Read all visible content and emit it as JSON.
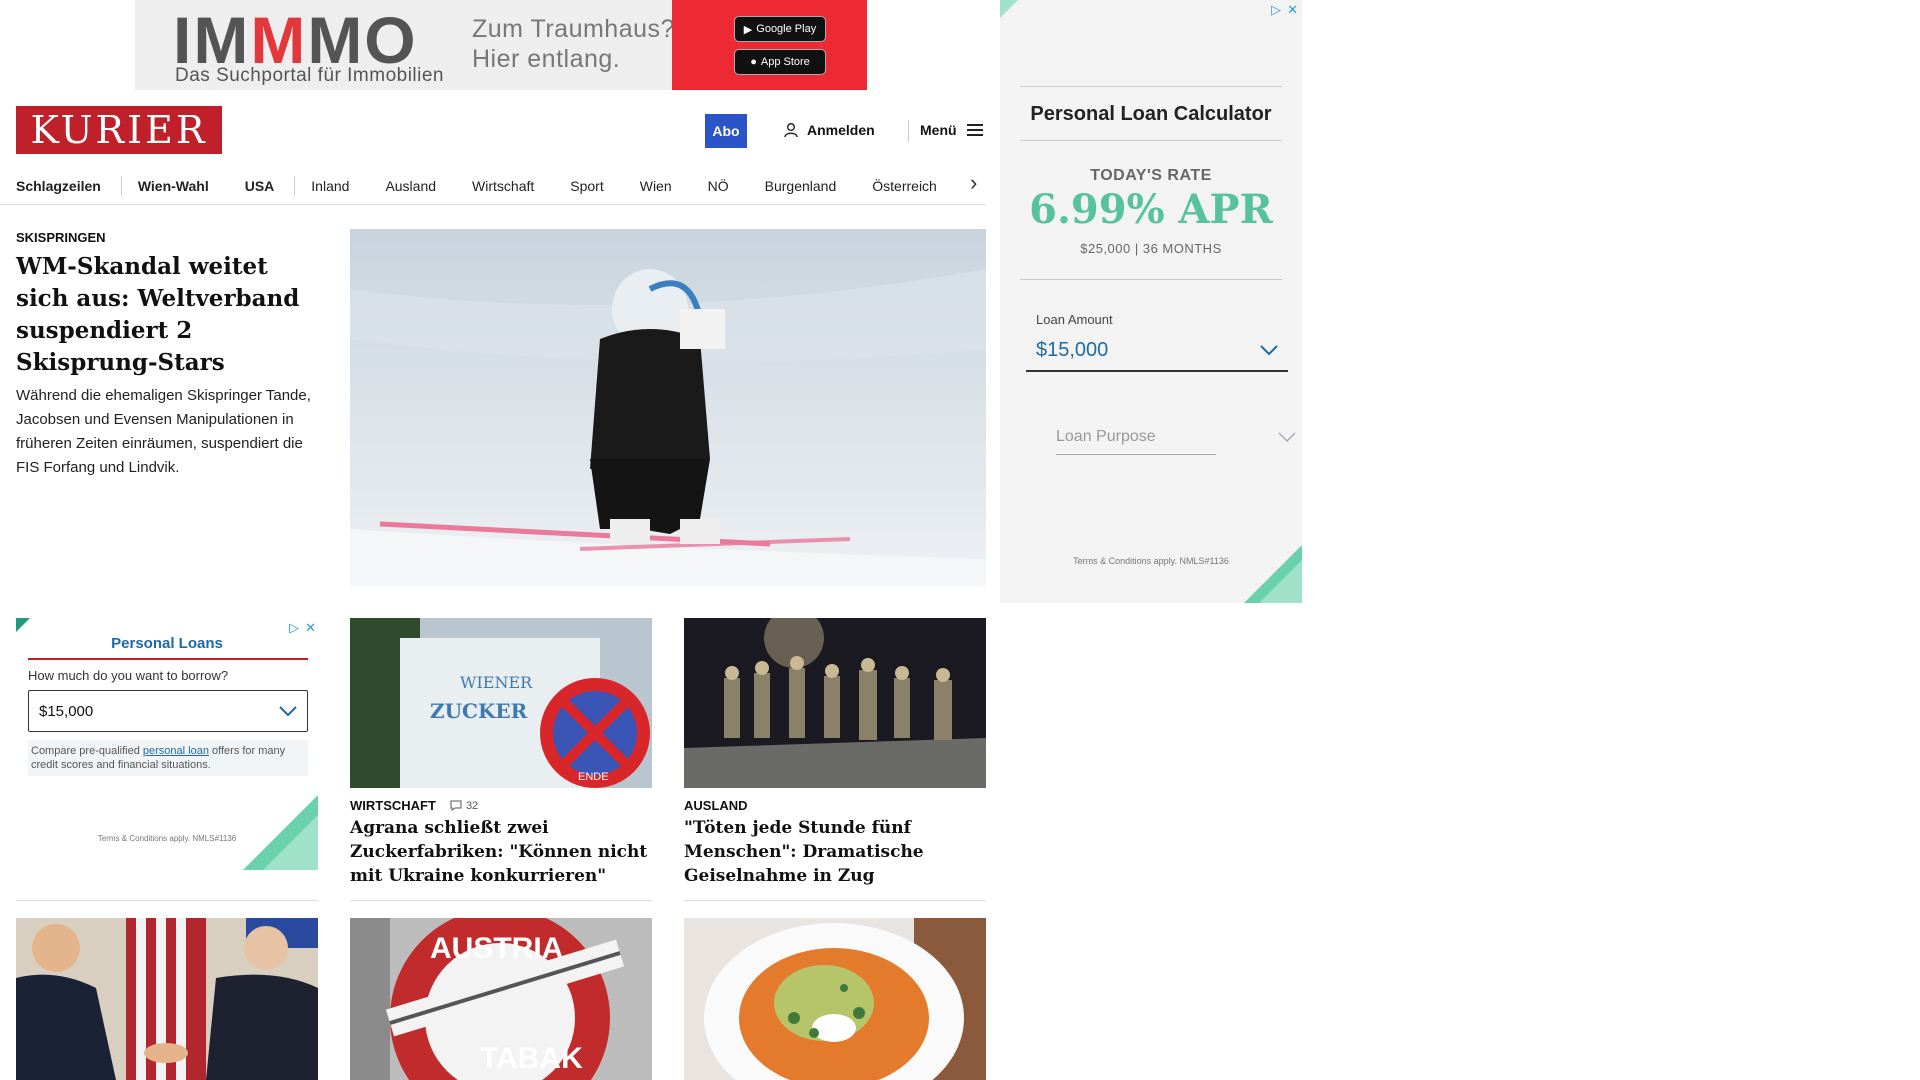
{
  "top_ad": {
    "logo_prefix": "IM",
    "logo_highlight": "M",
    "logo_suffix": "MO",
    "subtitle": "Das Suchportal für Immobilien",
    "slogan_line1": "Zum Traumhaus?",
    "slogan_line2": "Hier entlang.",
    "google_play_label": "Google Play",
    "app_store_label": "App Store"
  },
  "header": {
    "logo": "KURIER",
    "abo": "Abo",
    "login": "Anmelden",
    "menu": "Menü"
  },
  "nav": {
    "items": [
      "Schlagzeilen",
      "Wien-Wahl",
      "USA",
      "Inland",
      "Ausland",
      "Wirtschaft",
      "Sport",
      "Wien",
      "NÖ",
      "Burgenland",
      "Österreich"
    ]
  },
  "lead": {
    "kicker": "SKISPRINGEN",
    "title": "WM-Skandal weitet sich aus: Weltverband suspendiert 2 Skisprung-Stars",
    "teaser": "Während die ehemaligen Skispringer Tande, Jacobsen und Evensen Manipulationen in früheren Zeiten einräumen, suspendiert die FIS Forfang und Lindvik."
  },
  "left_ad": {
    "title": "Personal Loans",
    "question": "How much do you want to borrow?",
    "amount": "$15,000",
    "note_prefix": "Compare pre-qualified ",
    "note_link": "personal loan",
    "note_suffix": " offers for many credit scores and financial situations.",
    "terms": "Terms & Conditions apply. NMLS#1136"
  },
  "cards": [
    {
      "kicker": "WIRTSCHAFT",
      "comments": "32",
      "title": "Agrana schließt zwei Zuckerfabriken: \"Können nicht mit Ukraine konkurrieren\"",
      "img_text1": "WIENER",
      "img_text2": "ZUCKER",
      "img_text3": "ENDE"
    },
    {
      "kicker": "AUSLAND",
      "title": "\"Töten jede Stunde fünf Menschen\": Dramatische Geiselnahme in Zug"
    }
  ],
  "bottom_card_img_text1": "AUSTRIA",
  "bottom_card_img_text2": "TABAK",
  "right_ad": {
    "title": "Personal Loan Calculator",
    "rate_label": "TODAY'S RATE",
    "rate": "6.99% APR",
    "rate_sub": "$25,000 | 36 MONTHS",
    "amount_label": "Loan Amount",
    "amount": "$15,000",
    "purpose": "Loan Purpose",
    "terms": "Terms & Conditions apply. NMLS#1136"
  },
  "colors": {
    "kurier_red": "#c0202a",
    "abo_blue": "#2b55c7",
    "rate_green": "#56c29e",
    "ad_link_blue": "#1d6aa8"
  }
}
